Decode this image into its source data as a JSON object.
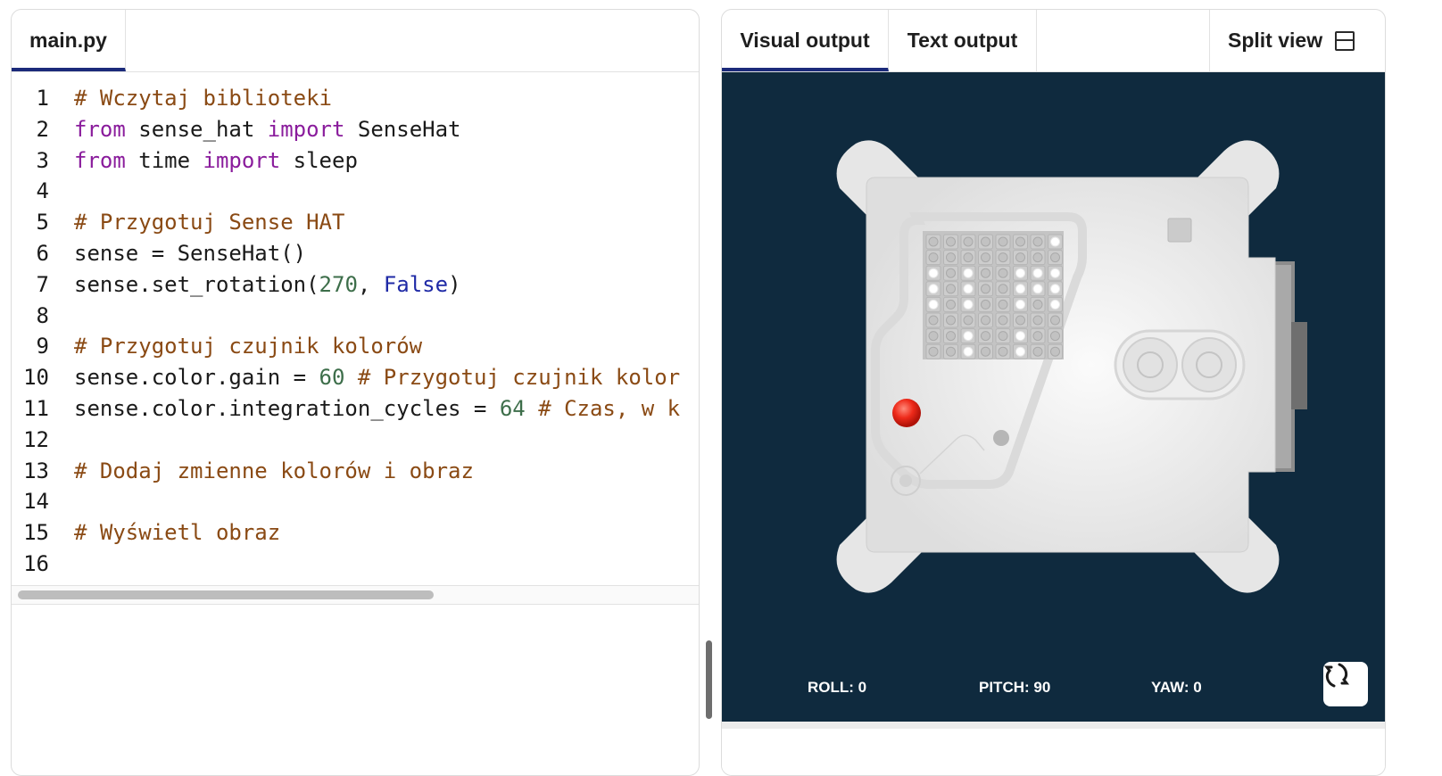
{
  "editor": {
    "file_tab": "main.py",
    "lines": [
      {
        "n": "1",
        "parts": [
          {
            "c": "cm",
            "t": "# Wczytaj biblioteki"
          }
        ]
      },
      {
        "n": "2",
        "parts": [
          {
            "c": "kw",
            "t": "from"
          },
          {
            "c": "",
            "t": " sense_hat "
          },
          {
            "c": "kw",
            "t": "import"
          },
          {
            "c": "",
            "t": " SenseHat"
          }
        ]
      },
      {
        "n": "3",
        "parts": [
          {
            "c": "kw",
            "t": "from"
          },
          {
            "c": "",
            "t": " time "
          },
          {
            "c": "kw",
            "t": "import"
          },
          {
            "c": "",
            "t": " sleep"
          }
        ]
      },
      {
        "n": "4",
        "parts": []
      },
      {
        "n": "5",
        "parts": [
          {
            "c": "cm",
            "t": "# Przygotuj Sense HAT"
          }
        ]
      },
      {
        "n": "6",
        "parts": [
          {
            "c": "",
            "t": "sense = SenseHat()"
          }
        ]
      },
      {
        "n": "7",
        "parts": [
          {
            "c": "",
            "t": "sense.set_rotation("
          },
          {
            "c": "nu",
            "t": "270"
          },
          {
            "c": "",
            "t": ", "
          },
          {
            "c": "bo",
            "t": "False"
          },
          {
            "c": "",
            "t": ")"
          }
        ]
      },
      {
        "n": "8",
        "parts": []
      },
      {
        "n": "9",
        "parts": [
          {
            "c": "cm",
            "t": "# Przygotuj czujnik kolorów"
          }
        ]
      },
      {
        "n": "10",
        "parts": [
          {
            "c": "",
            "t": "sense.color.gain = "
          },
          {
            "c": "nu",
            "t": "60"
          },
          {
            "c": "",
            "t": " "
          },
          {
            "c": "cm",
            "t": "# Przygotuj czujnik kolor"
          }
        ]
      },
      {
        "n": "11",
        "parts": [
          {
            "c": "",
            "t": "sense.color.integration_cycles = "
          },
          {
            "c": "nu",
            "t": "64"
          },
          {
            "c": "",
            "t": " "
          },
          {
            "c": "cm",
            "t": "# Czas, w k"
          }
        ]
      },
      {
        "n": "12",
        "parts": []
      },
      {
        "n": "13",
        "parts": [
          {
            "c": "cm",
            "t": "# Dodaj zmienne kolorów i obraz"
          }
        ]
      },
      {
        "n": "14",
        "parts": []
      },
      {
        "n": "15",
        "parts": [
          {
            "c": "cm",
            "t": "# Wyświetl obraz"
          }
        ]
      },
      {
        "n": "16",
        "parts": []
      }
    ]
  },
  "output": {
    "tabs": [
      "Visual output",
      "Text output"
    ],
    "split_view_label": "Split view",
    "canvas_bg": "#0f2a3e",
    "led_matrix": [
      "00000001",
      "00000000",
      "10100111",
      "10100111",
      "10100101",
      "00000000",
      "00100100",
      "00100100"
    ],
    "readouts": {
      "roll": "ROLL: 0",
      "pitch": "PITCH: 90",
      "yaw": "YAW: 0"
    },
    "reset_icon": "reset-orientation-icon"
  }
}
